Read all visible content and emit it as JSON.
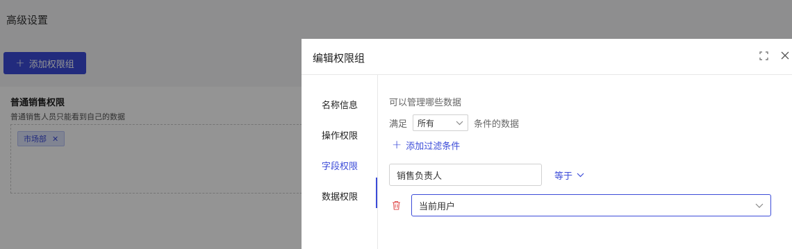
{
  "page": {
    "title": "高级设置",
    "add_group_label": "添加权限组"
  },
  "permission_card": {
    "title": "普通销售权限",
    "description": "普通销售人员只能看到自己的数据",
    "tags": [
      {
        "label": "市场部"
      }
    ]
  },
  "drawer": {
    "title": "编辑权限组",
    "icons": {
      "fullscreen": "fullscreen-icon",
      "close": "close-icon"
    },
    "nav": [
      {
        "label": "名称信息"
      },
      {
        "label": "操作权限"
      },
      {
        "label": "字段权限"
      },
      {
        "label": "数据权限"
      }
    ],
    "active_nav": "数据权限",
    "content": {
      "section_title": "可以管理哪些数据",
      "condition_prefix": "满足",
      "condition_select": "所有",
      "condition_suffix": "条件的数据",
      "add_filter_label": "添加过滤条件",
      "field_value": "销售负责人",
      "operator": "等于",
      "value": "当前用户"
    }
  },
  "colors": {
    "accent": "#3b4bd8",
    "danger": "#e05252",
    "overlay": "rgba(0,0,0,0.42)"
  }
}
